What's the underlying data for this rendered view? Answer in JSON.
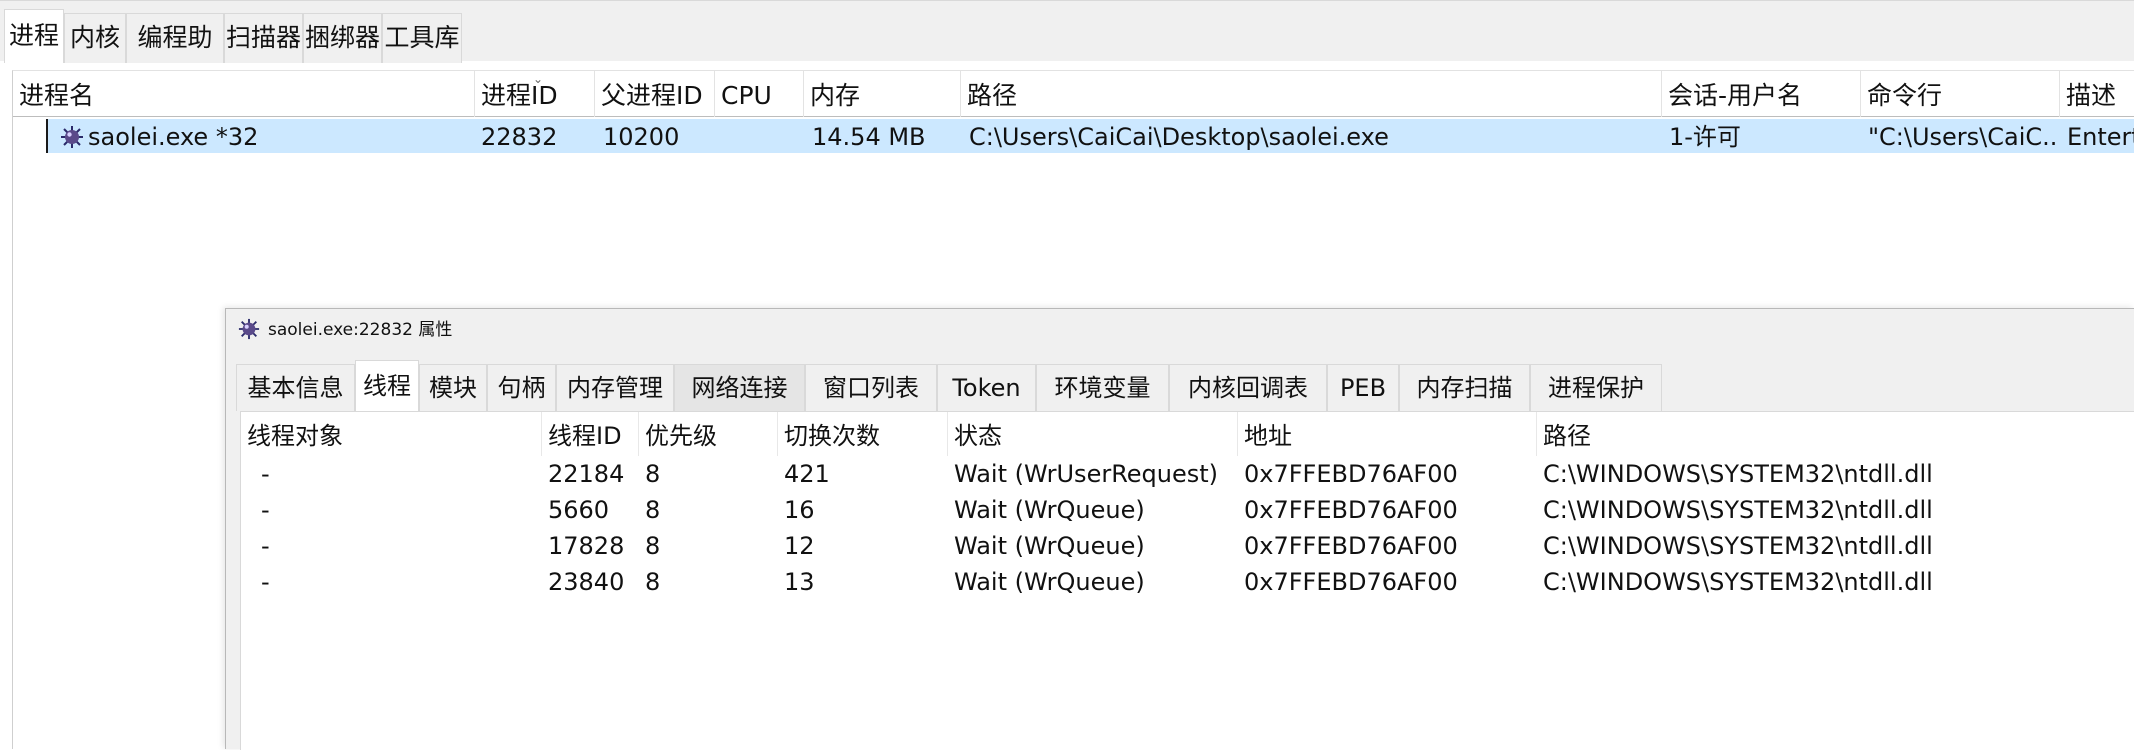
{
  "main_tabs": [
    "进程",
    "内核",
    "编程助手",
    "扫描器",
    "捆绑器",
    "工具库"
  ],
  "process_table": {
    "columns": [
      "进程名",
      "进程ID",
      "父进程ID",
      "CPU",
      "内存",
      "路径",
      "会话-用户名",
      "命令行",
      "描述"
    ],
    "rows": [
      {
        "name": "saolei.exe *32",
        "pid": "22832",
        "ppid": "10200",
        "cpu": "",
        "memory": "14.54 MB",
        "path": "C:\\Users\\CaiCai\\Desktop\\saolei.exe",
        "session_user": "1-许可",
        "cmdline": "\"C:\\Users\\CaiC...",
        "description": "Entert"
      }
    ]
  },
  "properties_window": {
    "title": "saolei.exe:22832 属性",
    "tabs": [
      "基本信息",
      "线程",
      "模块",
      "句柄",
      "内存管理",
      "网络连接",
      "窗口列表",
      "Token",
      "环境变量",
      "内核回调表",
      "PEB",
      "内存扫描",
      "进程保护"
    ],
    "active_tab": "线程",
    "thread_table": {
      "columns": [
        "线程对象",
        "线程ID",
        "优先级",
        "切换次数",
        "状态",
        "地址",
        "路径"
      ],
      "rows": [
        {
          "obj": "-",
          "tid": "22184",
          "priority": "8",
          "switches": "421",
          "state": "Wait (WrUserRequest)",
          "address": "0x7FFEBD76AF00",
          "path": "C:\\WINDOWS\\SYSTEM32\\ntdll.dll"
        },
        {
          "obj": "-",
          "tid": "5660",
          "priority": "8",
          "switches": "16",
          "state": "Wait (WrQueue)",
          "address": "0x7FFEBD76AF00",
          "path": "C:\\WINDOWS\\SYSTEM32\\ntdll.dll"
        },
        {
          "obj": "-",
          "tid": "17828",
          "priority": "8",
          "switches": "12",
          "state": "Wait (WrQueue)",
          "address": "0x7FFEBD76AF00",
          "path": "C:\\WINDOWS\\SYSTEM32\\ntdll.dll"
        },
        {
          "obj": "-",
          "tid": "23840",
          "priority": "8",
          "switches": "13",
          "state": "Wait (WrQueue)",
          "address": "0x7FFEBD76AF00",
          "path": "C:\\WINDOWS\\SYSTEM32\\ntdll.dll"
        }
      ]
    }
  },
  "icons": {
    "process": "saolei-mine-icon",
    "window": "saolei-mine-icon"
  },
  "colors": {
    "selection": "#cce8ff",
    "tab_bar": "#f0f0f0"
  }
}
